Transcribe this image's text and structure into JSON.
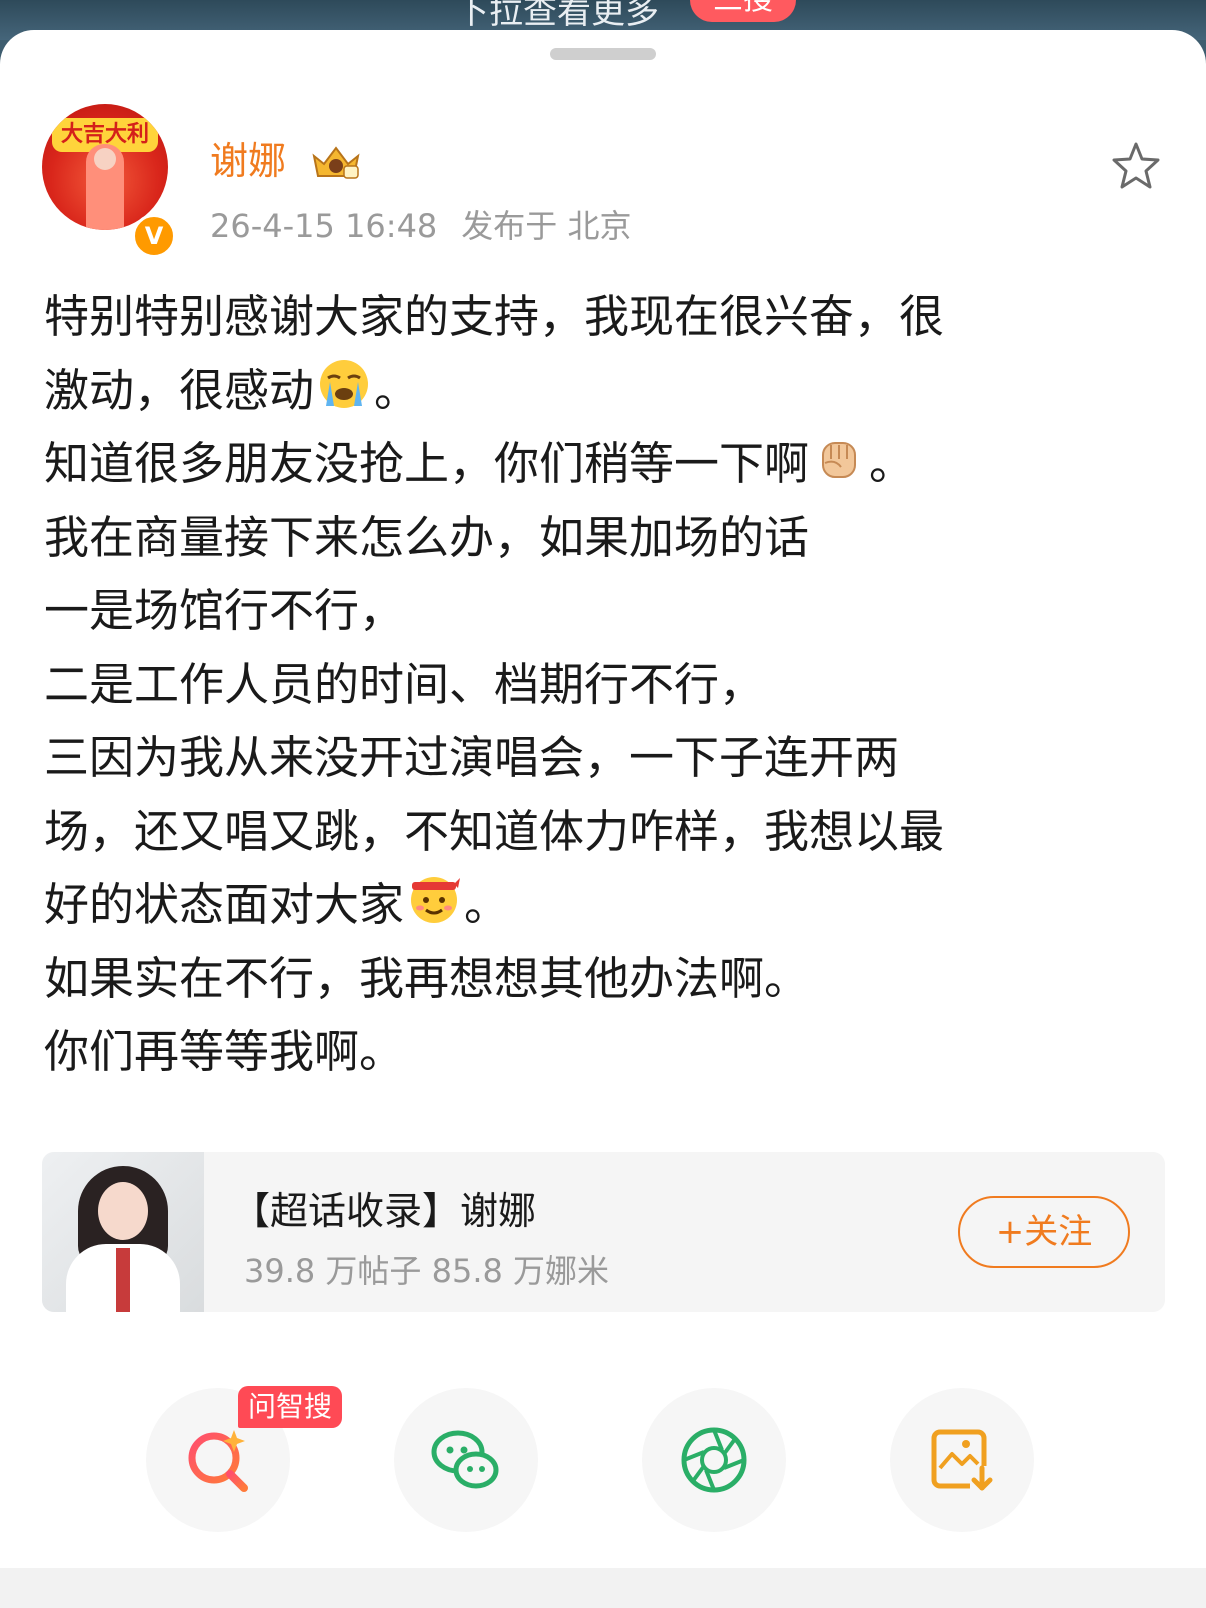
{
  "top_banner": {
    "pull_text": "下拉查看更多",
    "hot_badge": "三搜"
  },
  "post": {
    "author": "谢娜",
    "timestamp": "26-4-15 16:48",
    "location": "发布于 北京",
    "avatar_text": "大吉大利",
    "verified_mark": "V",
    "lines": [
      {
        "text": "特别特别感谢大家的支持，我现在很兴奋，很",
        "emoji": "",
        "tail": ""
      },
      {
        "text": "激动，很感动",
        "emoji": "crying-emoji",
        "tail": "。"
      },
      {
        "text": "知道很多朋友没抢上，你们稍等一下啊",
        "emoji": "fist-emoji",
        "tail": "。"
      },
      {
        "text": "我在商量接下来怎么办，如果加场的话",
        "emoji": "",
        "tail": ""
      },
      {
        "text": "一是场馆行不行，",
        "emoji": "",
        "tail": ""
      },
      {
        "text": "二是工作人员的时间、档期行不行，",
        "emoji": "",
        "tail": ""
      },
      {
        "text": "三因为我从来没开过演唱会，一下子连开两",
        "emoji": "",
        "tail": ""
      },
      {
        "text": "场，还又唱又跳，不知道体力咋样，我想以最",
        "emoji": "",
        "tail": ""
      },
      {
        "text": "好的状态面对大家",
        "emoji": "fighting-emoji",
        "tail": "。"
      },
      {
        "text": "如果实在不行，我再想想其他办法啊。",
        "emoji": "",
        "tail": ""
      },
      {
        "text": "你们再等等我啊。",
        "emoji": "",
        "tail": ""
      }
    ]
  },
  "topic_card": {
    "title": "【超话收录】谢娜",
    "stats": "39.8 万帖子 85.8 万娜米",
    "follow_label": "+关注"
  },
  "share_bar": {
    "ai_badge": "问智搜",
    "items": [
      "ai-search-icon",
      "wechat-icon",
      "moments-icon",
      "save-image-icon"
    ]
  },
  "colors": {
    "accent": "#f07b1f",
    "username": "#f07b1f",
    "badge_red": "#ff4a55",
    "wechat_green": "#2aae67"
  }
}
